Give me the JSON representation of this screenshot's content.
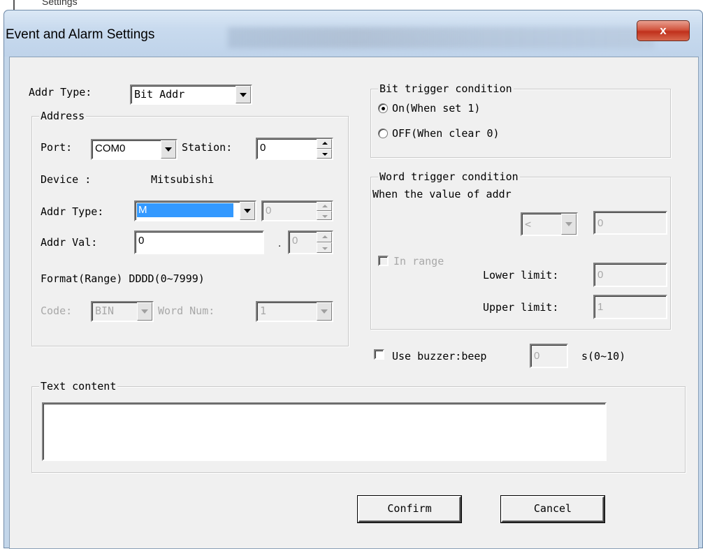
{
  "background_window": {
    "title_fragment": "Settings"
  },
  "dialog": {
    "title": "Event and Alarm Settings",
    "close_glyph": "x"
  },
  "addr_type_top": {
    "label": "Addr Type:",
    "value": "Bit Addr"
  },
  "address_group": {
    "title": "Address",
    "port_label": "Port:",
    "port_value": "COM0",
    "station_label": "Station:",
    "station_value": "0",
    "device_label": "Device :",
    "device_value": "Mitsubishi",
    "addr_type_label": "Addr Type:",
    "addr_type_value": "M",
    "addr_type_index": "0",
    "addr_val_label": "Addr Val:",
    "addr_val_value": "0",
    "addr_val_sep": ".",
    "addr_val_bit": "0",
    "format_text": "Format(Range) DDDD(0~7999)",
    "code_label": "Code:",
    "code_value": "BIN",
    "word_num_label": "Word Num:",
    "word_num_value": "1"
  },
  "bit_trigger": {
    "title": "Bit trigger condition",
    "options": [
      {
        "label": "On(When set 1)",
        "selected": true
      },
      {
        "label": "OFF(When clear 0)",
        "selected": false
      }
    ]
  },
  "word_trigger": {
    "title": "Word trigger condition",
    "desc": "When the value of addr",
    "compare_op": "<",
    "compare_value": "0",
    "in_range_label": "In range",
    "lower_label": "Lower limit:",
    "lower_value": "0",
    "upper_label": "Upper limit:",
    "upper_value": "1"
  },
  "buzzer": {
    "label": "Use buzzer:beep",
    "value": "0",
    "unit": "s(0~10)",
    "checked": false
  },
  "text_content": {
    "title": "Text content",
    "value": ""
  },
  "buttons": {
    "confirm": "Confirm",
    "cancel": "Cancel"
  },
  "colors": {
    "selection": "#3399ff",
    "close_button": "#c7422c",
    "titlebar": "#c8daee"
  }
}
